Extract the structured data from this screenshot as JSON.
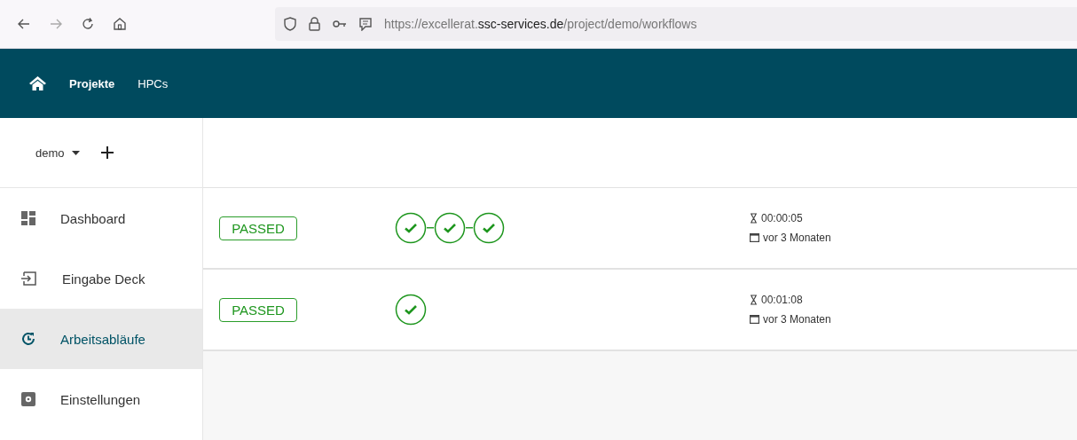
{
  "browser": {
    "url": "https://excellerat.**ssc-services.de**/project/demo/workflows"
  },
  "nav": {
    "items": [
      {
        "label": "Projekte",
        "selected": true
      },
      {
        "label": "HPCs",
        "selected": false
      }
    ]
  },
  "sidebar": {
    "project": "demo",
    "items": [
      {
        "label": "Dashboard",
        "kind": "dashboard",
        "selected": false
      },
      {
        "label": "Eingabe Deck",
        "kind": "input",
        "selected": false
      },
      {
        "label": "Arbeitsabläufe",
        "kind": "workflow",
        "selected": true
      },
      {
        "label": "Einstellungen",
        "kind": "settings",
        "selected": false
      }
    ]
  },
  "runs": [
    {
      "status": "PASSED",
      "steps": [
        {
          "passed": true
        },
        {
          "passed": true
        },
        {
          "passed": true
        }
      ],
      "duration": "00:00:05",
      "date": "vor 3 Monaten"
    },
    {
      "status": "PASSED",
      "steps": [
        {
          "passed": true
        }
      ],
      "duration": "00:01:08",
      "date": "vor 3 Monaten"
    }
  ]
}
